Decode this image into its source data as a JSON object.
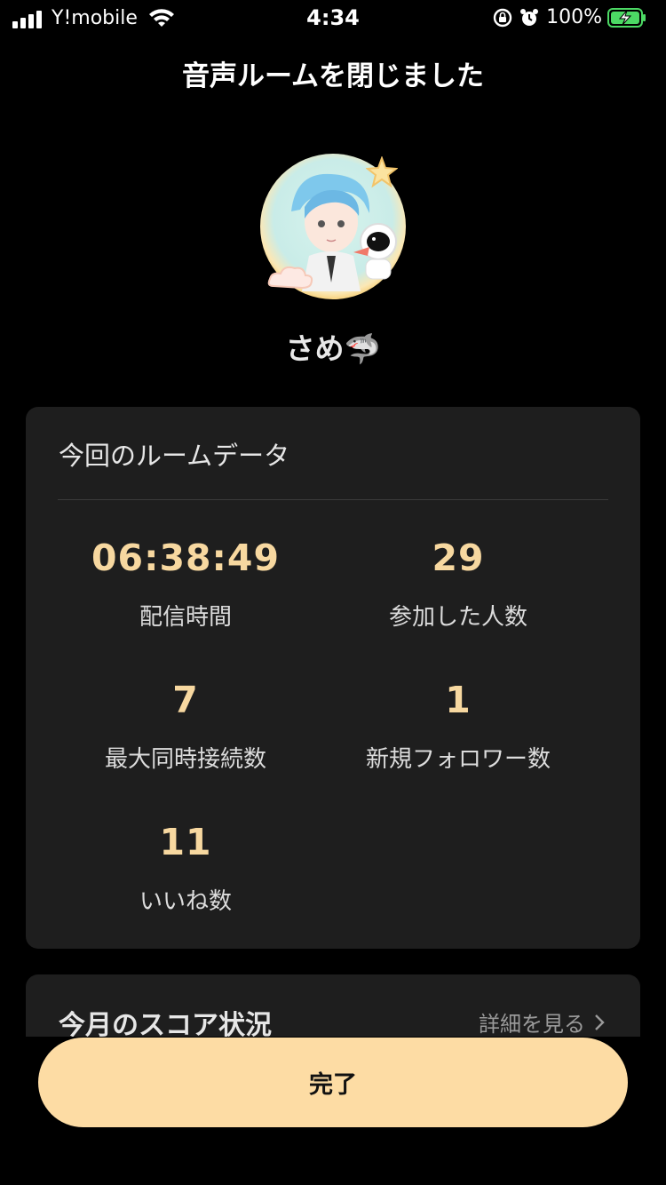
{
  "status_bar": {
    "carrier": "Y!mobile",
    "time": "4:34",
    "battery_percent": "100%"
  },
  "header": {
    "title": "音声ルームを閉じました"
  },
  "profile": {
    "username": "さめ🦈"
  },
  "room_data": {
    "title": "今回のルームデータ",
    "stats": [
      {
        "value": "06:38:49",
        "label": "配信時間"
      },
      {
        "value": "29",
        "label": "参加した人数"
      },
      {
        "value": "7",
        "label": "最大同時接続数"
      },
      {
        "value": "1",
        "label": "新規フォロワー数"
      },
      {
        "value": "11",
        "label": "いいね数"
      }
    ]
  },
  "score": {
    "title": "今月のスコア状況",
    "detail_link": "詳細を見る"
  },
  "footer": {
    "done_label": "完了"
  },
  "colors": {
    "accent": "#fddca4",
    "stat_value": "#f7d8a0",
    "card_bg": "#1e1e1e",
    "battery_green": "#4cd964"
  },
  "icons": [
    "signal-icon",
    "wifi-icon",
    "lock-rotation-icon",
    "alarm-icon",
    "battery-charging-icon",
    "chevron-right-icon"
  ]
}
